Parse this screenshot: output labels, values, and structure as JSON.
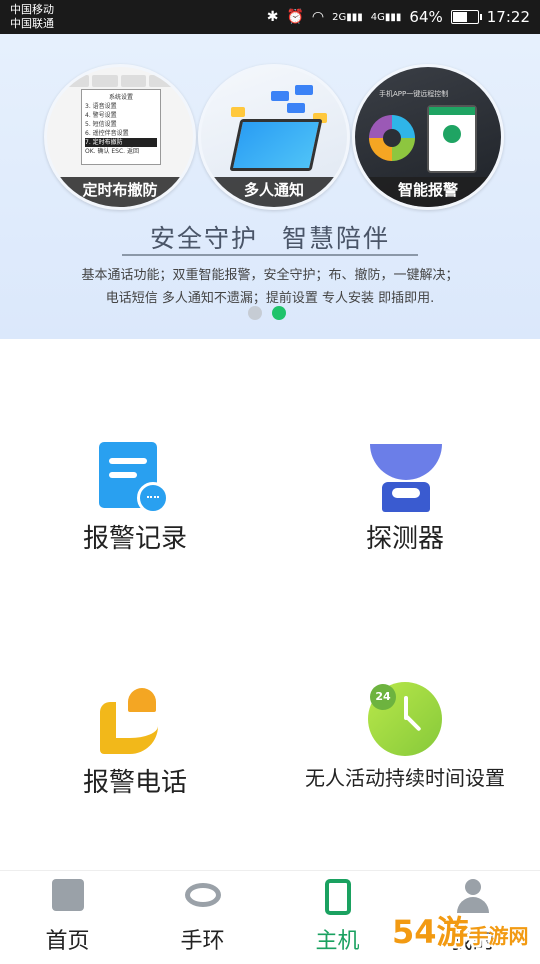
{
  "status_bar": {
    "carrier_1": "中国移动",
    "carrier_2": "中国联通",
    "network_2g": "2G",
    "network_4g": "4G",
    "battery": "64%",
    "battery_level": 0.64,
    "time": "17:22"
  },
  "banner": {
    "circles": [
      {
        "caption": "定时布撤防",
        "screen_title": "系统设置",
        "menu": [
          "3. 语音设置",
          "4. 警号设置",
          "5. 短信设置",
          "6. 遥控伴音设置",
          "7. 定时布撤防"
        ],
        "footer": "OK. 确认      ESC. 返回"
      },
      {
        "caption": "多人通知"
      },
      {
        "caption": "智能报警",
        "top_text": "手机APP一键远程控制"
      }
    ],
    "slogan_left": "安全守护",
    "slogan_right": "智慧陪伴",
    "desc_line1": "基本通话功能；双重智能报警，安全守护；布、撤防，一键解决；",
    "desc_line2": "电话短信  多人通知不遗漏；提前设置  专人安装  即插即用.",
    "dots": 2,
    "active_dot": 2
  },
  "grid": {
    "items": [
      {
        "label": "报警记录",
        "icon": "document-chat-icon"
      },
      {
        "label": "探测器",
        "icon": "detector-icon"
      },
      {
        "label": "报警电话",
        "icon": "phone-alarm-icon"
      },
      {
        "label": "无人活动持续时间设置",
        "icon": "clock-24-icon"
      }
    ]
  },
  "nav": {
    "items": [
      {
        "label": "首页",
        "icon": "home-icon"
      },
      {
        "label": "手环",
        "icon": "wristband-icon"
      },
      {
        "label": "主机",
        "icon": "host-device-icon"
      },
      {
        "label": "我的",
        "icon": "user-icon"
      }
    ],
    "active": "主机"
  },
  "watermark": {
    "text": "54游",
    "sub": "手游网"
  },
  "colors": {
    "accent_green": "#1aa160",
    "banner_bg": "#dbe8fb",
    "record_blue": "#29a0f0",
    "detector_blue": "#3a5bd0",
    "phone_yellow": "#f2b81a",
    "clock_green": "#86c93a"
  }
}
